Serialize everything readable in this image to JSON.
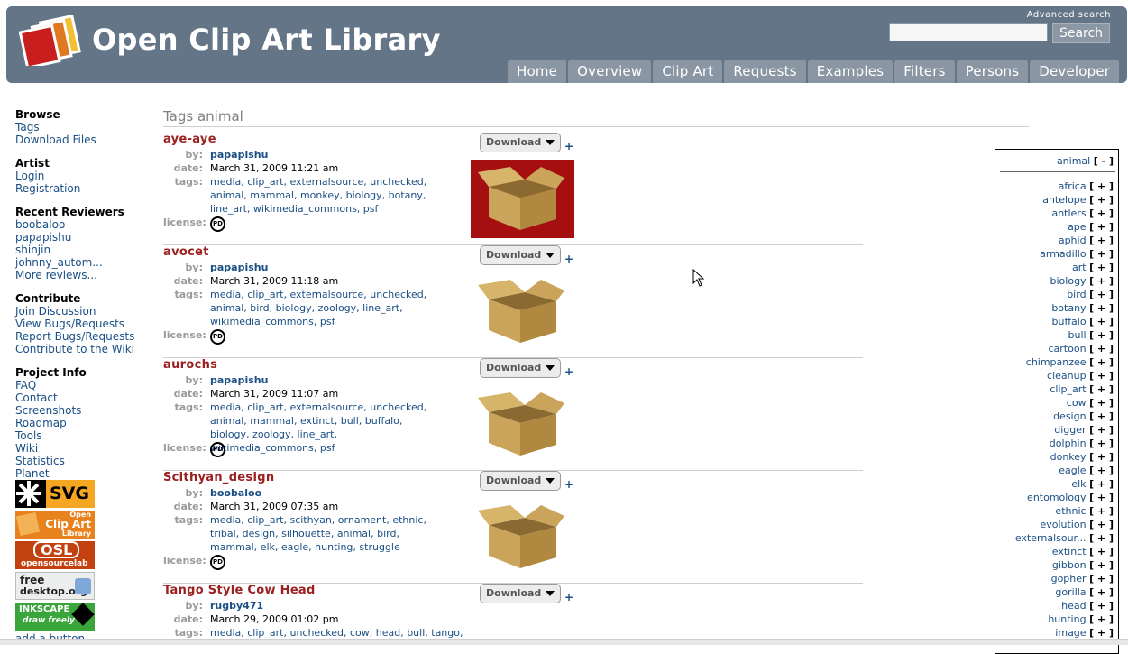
{
  "header": {
    "site_title": "Open Clip Art Library",
    "advanced_search": "Advanced search",
    "search_placeholder": "",
    "search_button": "Search",
    "nav": [
      "Home",
      "Overview",
      "Clip Art",
      "Requests",
      "Examples",
      "Filters",
      "Persons",
      "Developer"
    ]
  },
  "sidebar": {
    "sections": [
      {
        "heading": "Browse",
        "links": [
          "Tags",
          "Download Files"
        ]
      },
      {
        "heading": "Artist",
        "links": [
          "Login",
          "Registration"
        ]
      },
      {
        "heading": "Recent Reviewers",
        "links": [
          "boobaloo",
          "papapishu",
          "shinjin",
          "johnny_autom...",
          "More reviews..."
        ]
      },
      {
        "heading": "Contribute",
        "links": [
          "Join Discussion",
          "View Bugs/Requests",
          "Report Bugs/Requests",
          "Contribute to the Wiki"
        ]
      },
      {
        "heading": "Project Info",
        "links": [
          "FAQ",
          "Contact",
          "Screenshots",
          "Roadmap",
          "Tools",
          "Wiki",
          "Statistics",
          "Planet"
        ]
      }
    ],
    "badges": {
      "svg": "SVG",
      "ocal_line1": "Open",
      "ocal_line2": "Clip Art",
      "ocal_line3": "Library",
      "osl_line1": "OSL",
      "osl_line2": "opensourcelab",
      "fd_line1": "free",
      "fd_line2": "desktop.org",
      "inkscape_line1": "INKSCAPE",
      "inkscape_line2": "draw freely"
    },
    "add_button": "add a button..."
  },
  "main": {
    "heading": "Tags animal",
    "labels": {
      "by": "by:",
      "date": "date:",
      "tags": "tags:",
      "license": "license:",
      "download": "Download",
      "plus": "+",
      "pd": "PD"
    },
    "entries": [
      {
        "title": "aye-aye",
        "author": "papapishu",
        "date": "March 31, 2009 11:21 am",
        "tags": "media, clip_art, externalsource, unchecked, animal, mammal, monkey, biology, botany, line_art, wikimedia_commons, psf"
      },
      {
        "title": "avocet",
        "author": "papapishu",
        "date": "March 31, 2009 11:18 am",
        "tags": "media, clip_art, externalsource, unchecked, animal, bird, biology, zoology, line_art, wikimedia_commons, psf"
      },
      {
        "title": "aurochs",
        "author": "papapishu",
        "date": "March 31, 2009 11:07 am",
        "tags": "media, clip_art, externalsource, unchecked, animal, mammal, extinct, bull, buffalo, biology, zoology, line_art, wikimedia_commons, psf"
      },
      {
        "title": "Scithyan_design",
        "author": "boobaloo",
        "date": "March 31, 2009 07:35 am",
        "tags": "media, clip_art, scithyan, ornament, ethnic, tribal, design, silhouette, animal, bird, mammal, elk, eagle, hunting, struggle"
      },
      {
        "title": "Tango Style Cow Head",
        "author": "rugby471",
        "date": "March 29, 2009 01:02 pm",
        "tags": "media, clip_art, unchecked, cow, head, bull, tango,"
      }
    ]
  },
  "tag_panel": {
    "current": "animal",
    "remove": "[ - ]",
    "add": "[ + ]",
    "tags": [
      "africa",
      "antelope",
      "antlers",
      "ape",
      "aphid",
      "armadillo",
      "art",
      "biology",
      "bird",
      "botany",
      "buffalo",
      "bull",
      "cartoon",
      "chimpanzee",
      "cleanup",
      "clip_art",
      "cow",
      "design",
      "digger",
      "dolphin",
      "donkey",
      "eagle",
      "elk",
      "entomology",
      "ethnic",
      "evolution",
      "externalsour...",
      "extinct",
      "gibbon",
      "gopher",
      "gorilla",
      "head",
      "hunting",
      "image"
    ]
  },
  "colors": {
    "header_bg": "#647587",
    "nav_tab": "#8a96a3",
    "title_red": "#9c2020",
    "link_blue": "#1a4f85",
    "thumb_red_bg": "#a50f0f"
  }
}
